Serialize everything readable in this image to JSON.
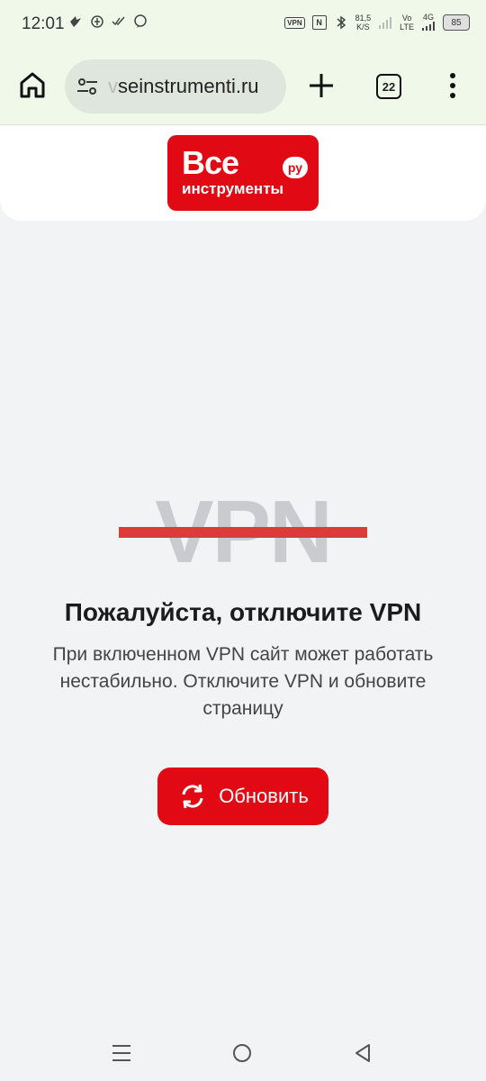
{
  "status_bar": {
    "time": "12:01",
    "vpn_label": "VPN",
    "nfc_label": "N",
    "speed_value": "81,5",
    "speed_unit": "K/S",
    "volte_top": "Vo",
    "volte_bottom": "LTE",
    "network": "4G",
    "battery": "85"
  },
  "browser": {
    "url_prefix": "v",
    "url": "seinstrumenti.ru",
    "tab_count": "22"
  },
  "site": {
    "logo_line1": "Все",
    "logo_line2": "инструменты",
    "logo_badge": "ру"
  },
  "main": {
    "vpn_word": "VPN",
    "title": "Пожалуйста, отключите VPN",
    "description": "При включенном VPN сайт может работать нестабильно. Отключите VPN и обновите страницу",
    "refresh_label": "Обновить"
  },
  "colors": {
    "accent": "#e10a14",
    "strike": "#dd3a3a",
    "background": "#f2f3f5"
  }
}
